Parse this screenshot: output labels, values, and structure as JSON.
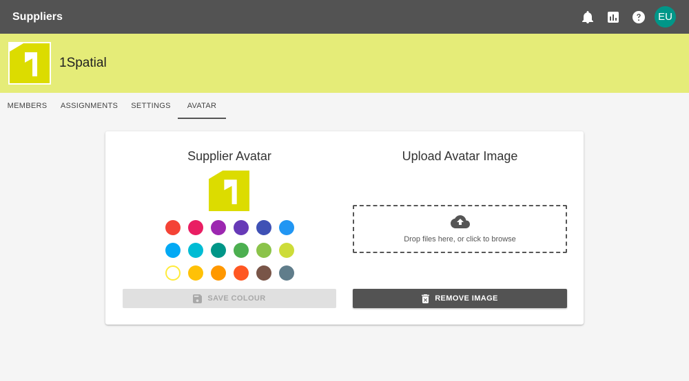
{
  "header": {
    "title": "Suppliers",
    "icons": [
      "bell-icon",
      "chart-icon",
      "help-icon"
    ],
    "user_initials": "EU",
    "avatar_color": "#009688",
    "bar_color": "#535353"
  },
  "supplier": {
    "name": "1Spatial",
    "logo_color": "#dcdc00",
    "banner_color": "#e5ec78"
  },
  "tabs": [
    {
      "label": "MEMBERS",
      "active": false
    },
    {
      "label": "ASSIGNMENTS",
      "active": false
    },
    {
      "label": "SETTINGS",
      "active": false
    },
    {
      "label": "AVATAR",
      "active": true
    }
  ],
  "avatar_panel": {
    "title": "Supplier Avatar",
    "swatch_colors": [
      "#f44336",
      "#e91e63",
      "#9c27b0",
      "#673ab7",
      "#3f51b5",
      "#2196f3",
      "#03a9f4",
      "#00bcd4",
      "#009688",
      "#4caf50",
      "#8bc34a",
      "#cddc39",
      "#ffeb3b",
      "#ffc107",
      "#ff9800",
      "#ff5722",
      "#795548",
      "#607d8b"
    ],
    "selected_index": 12,
    "save_label": "SAVE COLOUR",
    "save_disabled": true
  },
  "upload_panel": {
    "title": "Upload Avatar Image",
    "dropzone_text": "Drop files here, or click to browse",
    "remove_label": "REMOVE IMAGE"
  }
}
